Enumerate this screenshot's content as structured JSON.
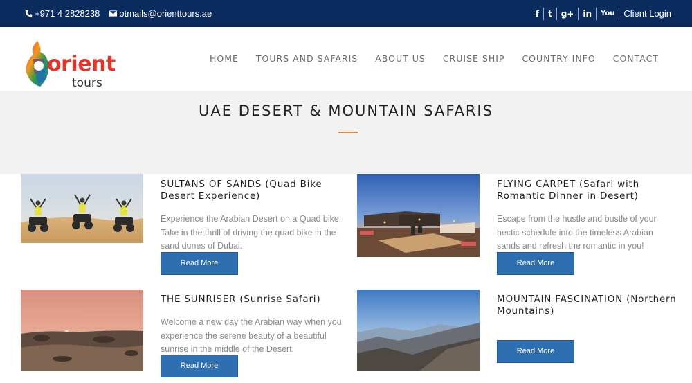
{
  "topbar": {
    "phone": "+971 4 2828238",
    "email": "otmails@orienttours.ae",
    "social_icons": [
      "facebook-icon",
      "twitter-icon",
      "google-plus-icon",
      "linkedin-icon",
      "youtube-icon"
    ],
    "social_glyphs": {
      "facebook": "f",
      "twitter": "t",
      "google": "g+",
      "linkedin": "in",
      "youtube": "You"
    },
    "login": "Client Login",
    "bg_color": "#0b2a5e"
  },
  "logo": {
    "word": "orient",
    "sub": "tours"
  },
  "nav": {
    "items": [
      "HOME",
      "TOURS AND SAFARIS",
      "ABOUT US",
      "CRUISE SHIP",
      "COUNTRY INFO",
      "CONTACT"
    ]
  },
  "page": {
    "title": "UAE DESERT & MOUNTAIN SAFARIS",
    "accent_color": "#e4873a"
  },
  "cards": [
    {
      "title": "SULTANS OF SANDS (Quad Bike Desert Experience)",
      "description": "Experience the Arabian Desert on a Quad bike. Take in the thrill of driving the quad bike in the sand dunes of Dubai.",
      "button": "Read More"
    },
    {
      "title": "FLYING CARPET (Safari with Romantic Dinner in Desert)",
      "description": "Escape from the hustle and bustle of your hectic schedule into the timeless Arabian sands and refresh the romantic in you!",
      "button": "Read More"
    },
    {
      "title": "THE SUNRISER (Sunrise Safari)",
      "description": "Welcome a new day the Arabian way when you experience the serene beauty of a beautiful sunrise in the middle of the Desert.",
      "button": "Read More"
    },
    {
      "title": "MOUNTAIN FASCINATION (Northern Mountains)",
      "description": "",
      "button": "Read More"
    }
  ],
  "button_color": "#2e6fb1"
}
